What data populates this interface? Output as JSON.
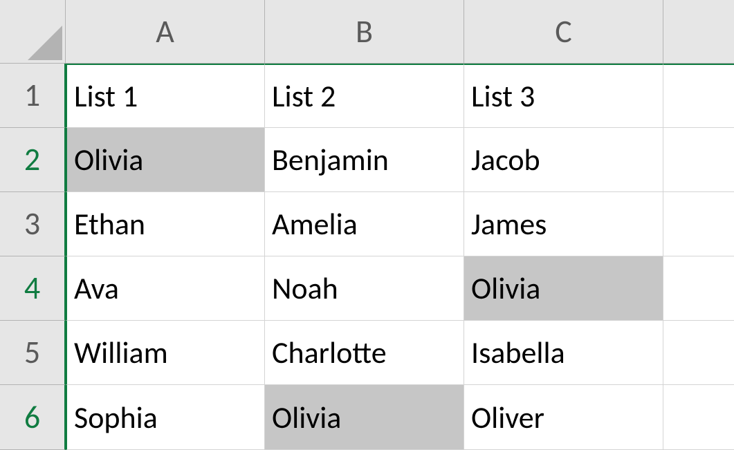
{
  "columns": [
    "A",
    "B",
    "C"
  ],
  "rows": [
    "1",
    "2",
    "3",
    "4",
    "5",
    "6"
  ],
  "headers": {
    "A": "List 1",
    "B": "List 2",
    "C": "List 3"
  },
  "data": {
    "A2": "Olivia",
    "A3": "Ethan",
    "A4": "Ava",
    "A5": "William",
    "A6": "Sophia",
    "B2": "Benjamin",
    "B3": "Amelia",
    "B4": "Noah",
    "B5": "Charlotte",
    "B6": "Olivia",
    "C2": "Jacob",
    "C3": "James",
    "C4": "Olivia",
    "C5": "Isabella",
    "C6": "Oliver"
  },
  "highlighted_cells": [
    "A2",
    "B6",
    "C4"
  ],
  "chart_data": {
    "type": "table",
    "title": "",
    "columns": [
      "List 1",
      "List 2",
      "List 3"
    ],
    "rows": [
      [
        "Olivia",
        "Benjamin",
        "Jacob"
      ],
      [
        "Ethan",
        "Amelia",
        "James"
      ],
      [
        "Ava",
        "Noah",
        "Olivia"
      ],
      [
        "William",
        "Charlotte",
        "Isabella"
      ],
      [
        "Sophia",
        "Olivia",
        "Oliver"
      ]
    ]
  }
}
